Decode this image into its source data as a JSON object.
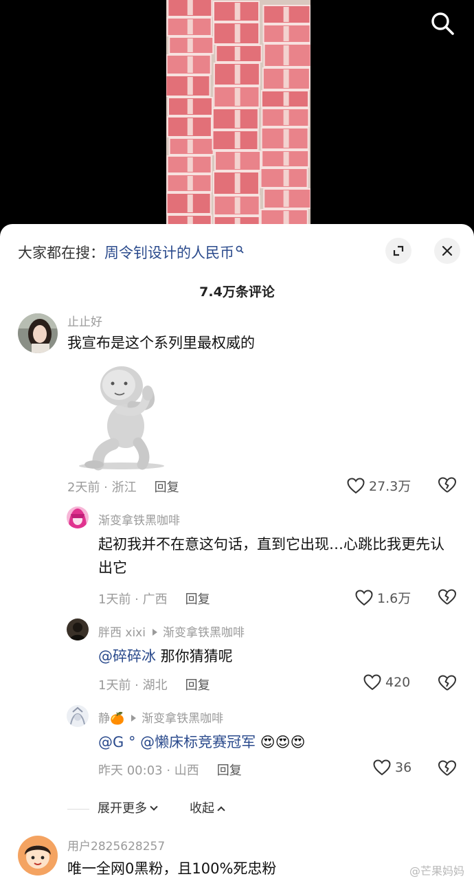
{
  "sheet": {
    "search_prefix": "大家都在搜：",
    "search_link": "周令钊设计的人民币",
    "comment_count": "7.4万条评论"
  },
  "comments": [
    {
      "username": "止止好",
      "text": "我宣布是这个系列里最权威的",
      "time_location": "2天前 · 浙江",
      "reply_label": "回复",
      "likes": "27.3万"
    },
    {
      "username": "渐变拿铁黑咖啡",
      "text": "起初我并不在意这句话，直到它出现…心跳比我更先认出它",
      "time_location": "1天前 · 广西",
      "reply_label": "回复",
      "likes": "1.6万"
    },
    {
      "username": "胖西 xixi",
      "reply_to": "渐变拿铁黑咖啡",
      "mention": "@碎碎冰",
      "text": " 那你猜猜呢",
      "time_location": "1天前 · 湖北",
      "reply_label": "回复",
      "likes": "420"
    },
    {
      "username": "静🍊",
      "reply_to": "渐变拿铁黑咖啡",
      "mention": "@G ° @懒床标竞赛冠军",
      "text": " 😍😍😍",
      "time_location": "昨天 00:03 · 山西",
      "reply_label": "回复",
      "likes": "36"
    },
    {
      "username": "用户2825628257",
      "text": "唯一全网0黑粉，且100%死忠粉"
    }
  ],
  "thread": {
    "expand_more": "展开更多",
    "collapse": "收起"
  },
  "watermark": "@芒果妈妈",
  "colors": {
    "link": "#2a4a8c",
    "secondary_text": "#9a9a9a",
    "banknote": "#e9838a"
  },
  "icons": [
    "search-icon",
    "expand-icon",
    "close-icon",
    "heart-icon",
    "broken-heart-icon",
    "chevron-down-icon",
    "chevron-up-icon"
  ]
}
